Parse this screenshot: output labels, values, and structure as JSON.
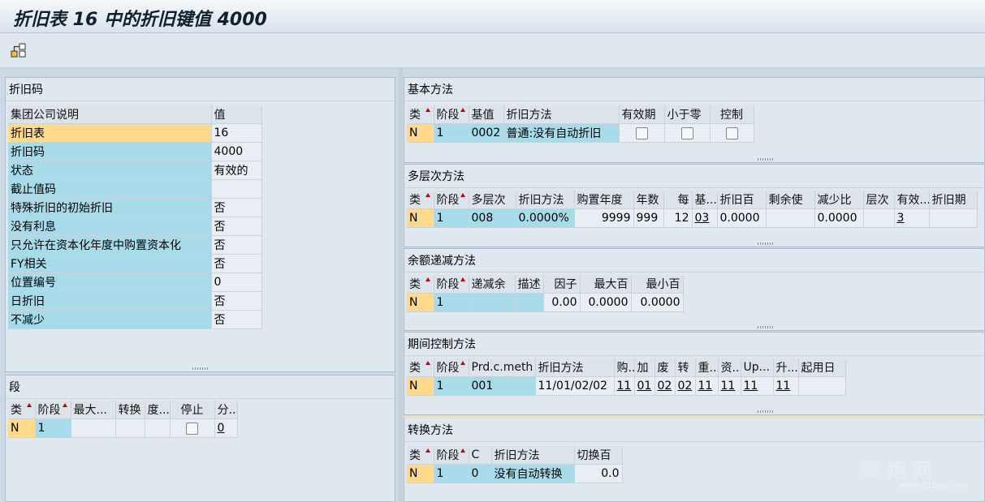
{
  "window": {
    "title": "折旧表 16 中的折旧键值 4000"
  },
  "toolbar": {
    "icon": "hierarchy-icon"
  },
  "left_top": {
    "title": "折旧码",
    "headers": [
      "集团公司说明",
      "值"
    ],
    "rows": [
      {
        "label": "折旧表",
        "value": "16"
      },
      {
        "label": "折旧码",
        "value": "4000"
      },
      {
        "label": "状态",
        "value": "有效的"
      },
      {
        "label": "截止值码",
        "value": ""
      },
      {
        "label": "特殊折旧的初始折旧",
        "value": "否"
      },
      {
        "label": "没有利息",
        "value": "否"
      },
      {
        "label": "只允许在资本化年度中购置资本化",
        "value": "否"
      },
      {
        "label": "FY相关",
        "value": "否"
      },
      {
        "label": "位置编号",
        "value": "0"
      },
      {
        "label": "日折旧",
        "value": "否"
      },
      {
        "label": "不减少",
        "value": "否"
      }
    ]
  },
  "left_bottom": {
    "title": "段",
    "headers": [
      "类",
      "阶段",
      "最大...",
      "转换",
      "度...",
      "停止",
      "分..."
    ],
    "row": {
      "cls": "N",
      "stage": "1",
      "max": "",
      "conv": "",
      "deg": "",
      "stop": "",
      "div": "0"
    }
  },
  "basic": {
    "title": "基本方法",
    "headers": [
      "类",
      "阶段",
      "基值",
      "折旧方法",
      "有效期",
      "小于零",
      "控制"
    ],
    "row": {
      "cls": "N",
      "stage": "1",
      "base": "0002",
      "method": "普通:没有自动折旧"
    }
  },
  "multi": {
    "title": "多层次方法",
    "headers": [
      "类",
      "阶段",
      "多层次",
      "折旧方法",
      "购置年度",
      "年数",
      "每",
      "基...",
      "折旧百",
      "剩余使",
      "减少比",
      "层次",
      "有效...",
      "折旧期"
    ],
    "row": {
      "cls": "N",
      "stage": "1",
      "level": "008",
      "method": "0.0000%",
      "year": "9999",
      "years": "999",
      "per": "12",
      "base": "03",
      "pct": "0.0000",
      "rest": "",
      "red": "0.0000",
      "layer": "",
      "valid": "3",
      "period": ""
    }
  },
  "declining": {
    "title": "余额递减方法",
    "headers": [
      "类",
      "阶段",
      "递减余",
      "描述",
      "因子",
      "最大百",
      "最小百"
    ],
    "row": {
      "cls": "N",
      "stage": "1",
      "dec": "",
      "desc": "",
      "factor": "0.00",
      "max": "0.0000",
      "min": "0.0000"
    }
  },
  "period": {
    "title": "期间控制方法",
    "headers": [
      "类",
      "阶段",
      "Prd.c.meth",
      "折旧方法",
      "购...",
      "加",
      "废",
      "转",
      "重...",
      "资...",
      "Up...",
      "升...",
      "起用日"
    ],
    "row": {
      "cls": "N",
      "stage": "1",
      "prd": "001",
      "method": "11/01/02/02",
      "buy": "11",
      "add": "01",
      "scrap": "02",
      "trans": "02",
      "re": "11",
      "cap": "11",
      "up": "11",
      "rise": "11",
      "start": ""
    }
  },
  "switch": {
    "title": "转换方法",
    "headers": [
      "类",
      "阶段",
      "C",
      "折旧方法",
      "切换百"
    ],
    "row": {
      "cls": "N",
      "stage": "1",
      "c": "0",
      "method": "没有自动转换",
      "pct": "0.0"
    }
  },
  "watermark": {
    "text": "赛 跑 网",
    "url": "www.91Sap.com"
  }
}
